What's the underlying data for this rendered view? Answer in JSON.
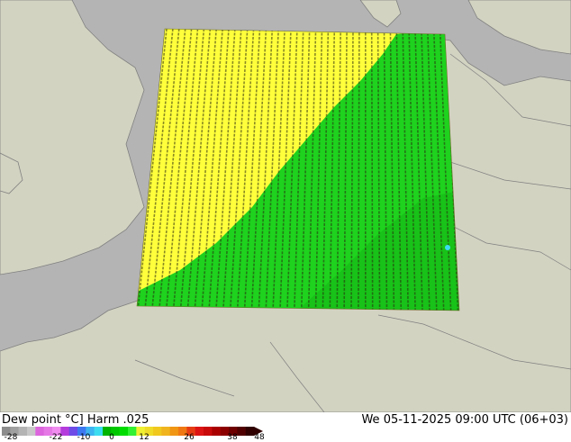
{
  "title": "Dew point °C] Harm .025",
  "datetime": "We 05-11-2025 09:00 UTC (06+03)",
  "colorbar": {
    "colors": [
      "#8c8c8c",
      "#a0a0a0",
      "#b4b4b4",
      "#c8c8c8",
      "#dc64dc",
      "#e678e6",
      "#f08cf0",
      "#b43cdc",
      "#6e4be6",
      "#3c78f0",
      "#3cb4f0",
      "#3cdcf0",
      "#00b400",
      "#00c800",
      "#00dc00",
      "#32f032",
      "#f0f032",
      "#f0dc28",
      "#f0c81e",
      "#f0b41e",
      "#f09614",
      "#f07814",
      "#e63c14",
      "#dc1414",
      "#c80a0a",
      "#aa0000",
      "#8c0000",
      "#6e0000",
      "#500000",
      "#300000"
    ],
    "tick_labels": [
      "-28",
      "-22",
      "-10",
      "0",
      "12",
      "26",
      "38",
      "48"
    ],
    "tick_values": [
      -28,
      -22,
      -10,
      0,
      12,
      26,
      38,
      48
    ]
  },
  "field": {
    "values_yellow": [
      "21",
      "21",
      "21",
      "2121",
      "21",
      "21"
    ],
    "values_green": [
      "2",
      "3",
      "2",
      "3",
      "4",
      "2"
    ]
  },
  "colors": {
    "land": "#d3d3c2",
    "sea": "#b4b4b4",
    "border": "#808080",
    "yellow_zone": "#ffff3c",
    "green_zone": "#1ed21e",
    "dark_green": "#14b414"
  }
}
